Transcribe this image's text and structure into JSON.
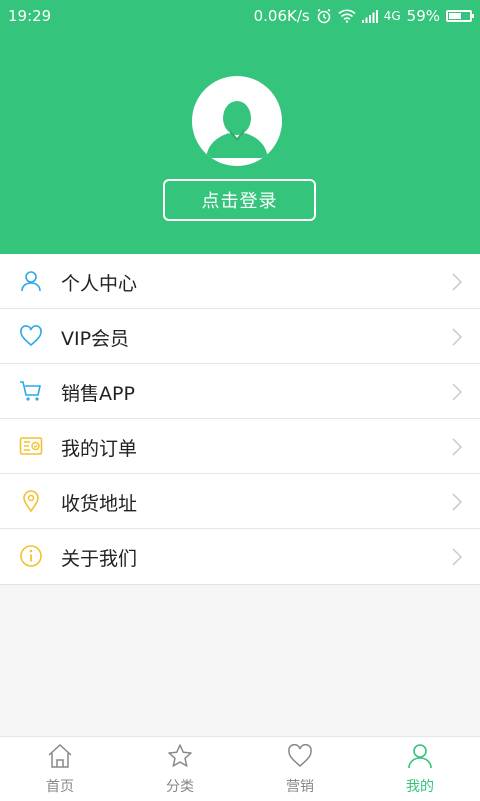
{
  "status_bar": {
    "time": "19:29",
    "network_speed": "0.06K/s",
    "network_type": "4G",
    "battery_percent": "59%",
    "battery_level": 0.59
  },
  "header": {
    "login_label": "点击登录"
  },
  "menu": {
    "items": [
      {
        "label": "个人中心",
        "icon": "person-icon"
      },
      {
        "label": "VIP会员",
        "icon": "heart-icon"
      },
      {
        "label": "销售APP",
        "icon": "cart-icon"
      },
      {
        "label": "我的订单",
        "icon": "order-icon"
      },
      {
        "label": "收货地址",
        "icon": "location-pin-icon"
      },
      {
        "label": "关于我们",
        "icon": "info-icon"
      }
    ]
  },
  "tabbar": {
    "tabs": [
      {
        "label": "首页",
        "icon": "home-icon"
      },
      {
        "label": "分类",
        "icon": "star-icon"
      },
      {
        "label": "营销",
        "icon": "heart-icon"
      },
      {
        "label": "我的",
        "icon": "person-icon",
        "active": true
      }
    ]
  },
  "colors": {
    "brand": "#34c47c",
    "icon_blue": "#29a9e6",
    "icon_yellow": "#f4c12e",
    "text_gray": "#888888"
  }
}
